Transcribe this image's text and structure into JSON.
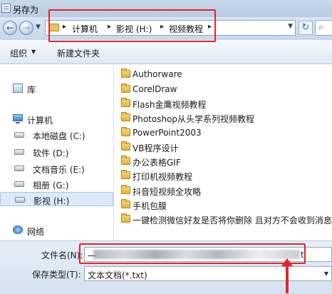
{
  "window": {
    "title": "另存为"
  },
  "address_bar": {
    "crumbs": [
      "计算机",
      "影视 (H:)",
      "视频教程"
    ]
  },
  "toolbar": {
    "organize": "组织",
    "new_folder": "新建文件夹"
  },
  "sidebar": {
    "libraries": "库",
    "computer": "计算机",
    "drives": [
      "本地磁盘 (C:)",
      "软件 (D:)",
      "文档音乐 (E:)",
      "相册 (G:)",
      "影视 (H:)"
    ],
    "selected": "影视 (H:)",
    "network": "网络"
  },
  "files": [
    "Authorware",
    "CorelDraw",
    "Flash金鹰视频教程",
    "Photoshop从头学系列视频教程",
    "PowerPoint2003",
    "VB程序设计",
    "办公表格GIF",
    "打印机视频教程",
    "抖音短视频全攻略",
    "手机包膜",
    "一键检测微信好友是否将你删除 且对方不会收到消息"
  ],
  "bottom": {
    "filename_label": "文件名(N):",
    "filename_value_start": "一",
    "filename_value_end": "t",
    "type_label": "保存类型(T):",
    "type_value": "文本文档(*.txt)"
  },
  "colors": {
    "highlight": "#e1262a"
  }
}
